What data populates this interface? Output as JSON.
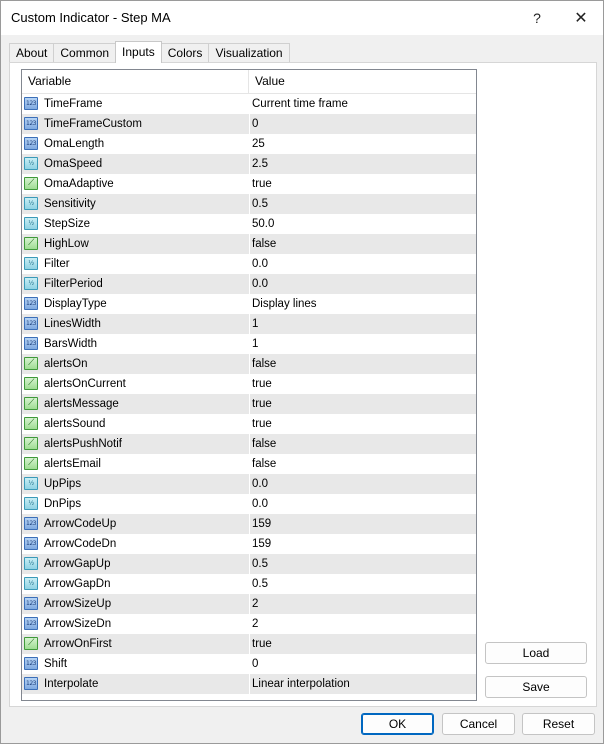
{
  "window": {
    "title": "Custom Indicator - Step MA",
    "help_label": "?",
    "close_label": "✕"
  },
  "tabs": [
    {
      "label": "About"
    },
    {
      "label": "Common"
    },
    {
      "label": "Inputs",
      "active": true
    },
    {
      "label": "Colors"
    },
    {
      "label": "Visualization"
    }
  ],
  "grid": {
    "columns": [
      "Variable",
      "Value"
    ],
    "rows": [
      {
        "name": "TimeFrame",
        "value": "Current time frame",
        "type": "int"
      },
      {
        "name": "TimeFrameCustom",
        "value": "0",
        "type": "int"
      },
      {
        "name": "OmaLength",
        "value": "25",
        "type": "int"
      },
      {
        "name": "OmaSpeed",
        "value": "2.5",
        "type": "double"
      },
      {
        "name": "OmaAdaptive",
        "value": "true",
        "type": "bool"
      },
      {
        "name": "Sensitivity",
        "value": "0.5",
        "type": "double"
      },
      {
        "name": "StepSize",
        "value": "50.0",
        "type": "double"
      },
      {
        "name": "HighLow",
        "value": "false",
        "type": "bool"
      },
      {
        "name": "Filter",
        "value": "0.0",
        "type": "double"
      },
      {
        "name": "FilterPeriod",
        "value": "0.0",
        "type": "double"
      },
      {
        "name": "DisplayType",
        "value": "Display lines",
        "type": "int"
      },
      {
        "name": "LinesWidth",
        "value": "1",
        "type": "int"
      },
      {
        "name": "BarsWidth",
        "value": "1",
        "type": "int"
      },
      {
        "name": "alertsOn",
        "value": "false",
        "type": "bool"
      },
      {
        "name": "alertsOnCurrent",
        "value": "true",
        "type": "bool"
      },
      {
        "name": "alertsMessage",
        "value": "true",
        "type": "bool"
      },
      {
        "name": "alertsSound",
        "value": "true",
        "type": "bool"
      },
      {
        "name": "alertsPushNotif",
        "value": "false",
        "type": "bool"
      },
      {
        "name": "alertsEmail",
        "value": "false",
        "type": "bool"
      },
      {
        "name": "UpPips",
        "value": "0.0",
        "type": "double"
      },
      {
        "name": "DnPips",
        "value": "0.0",
        "type": "double"
      },
      {
        "name": "ArrowCodeUp",
        "value": "159",
        "type": "int"
      },
      {
        "name": "ArrowCodeDn",
        "value": "159",
        "type": "int"
      },
      {
        "name": "ArrowGapUp",
        "value": "0.5",
        "type": "double"
      },
      {
        "name": "ArrowGapDn",
        "value": "0.5",
        "type": "double"
      },
      {
        "name": "ArrowSizeUp",
        "value": "2",
        "type": "int"
      },
      {
        "name": "ArrowSizeDn",
        "value": "2",
        "type": "int"
      },
      {
        "name": "ArrowOnFirst",
        "value": "true",
        "type": "bool"
      },
      {
        "name": "Shift",
        "value": "0",
        "type": "int"
      },
      {
        "name": "Interpolate",
        "value": "Linear interpolation",
        "type": "int"
      }
    ]
  },
  "buttons": {
    "load": "Load",
    "save": "Save",
    "ok": "OK",
    "cancel": "Cancel",
    "reset": "Reset"
  },
  "icon_glyphs": {
    "int": "123",
    "double": "½",
    "bool": "⟋"
  }
}
